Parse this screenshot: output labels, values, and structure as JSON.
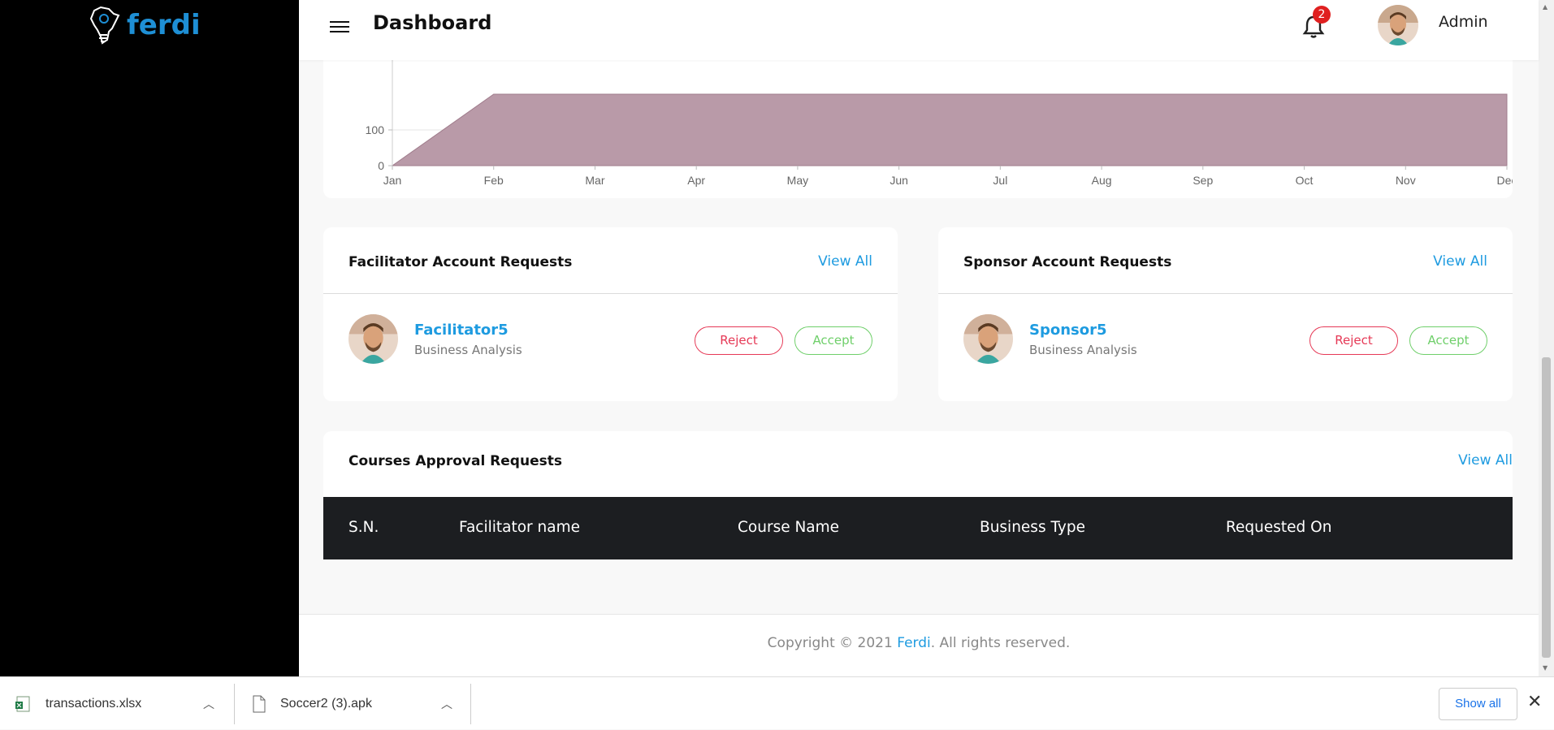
{
  "brand": {
    "name": "ferdi"
  },
  "header": {
    "title": "Dashboard",
    "notifications_count": "2",
    "user_name": "Admin"
  },
  "chart_data": {
    "type": "area",
    "x": [
      "Jan",
      "Feb",
      "Mar",
      "Apr",
      "May",
      "Jun",
      "Jul",
      "Aug",
      "Sep",
      "Oct",
      "Nov",
      "Dec"
    ],
    "series": [
      {
        "values": [
          0,
          200,
          200,
          200,
          200,
          200,
          200,
          200,
          200,
          200,
          200,
          200
        ],
        "color": "#b99aa8"
      }
    ],
    "y_ticks": [
      "0",
      "100"
    ],
    "ylim": [
      0,
      200
    ],
    "grid": true
  },
  "facilitator_requests": {
    "title": "Facilitator Account Requests",
    "view_all": "View All",
    "item": {
      "name": "Facilitator5",
      "subtitle": "Business Analysis",
      "reject": "Reject",
      "accept": "Accept"
    }
  },
  "sponsor_requests": {
    "title": "Sponsor Account Requests",
    "view_all": "View All",
    "item": {
      "name": "Sponsor5",
      "subtitle": "Business Analysis",
      "reject": "Reject",
      "accept": "Accept"
    }
  },
  "course_requests": {
    "title": "Courses Approval Requests",
    "view_all": "View All",
    "columns": [
      "S.N.",
      "Facilitator name",
      "Course Name",
      "Business Type",
      "Requested On"
    ]
  },
  "footer": {
    "prefix": "Copyright © 2021 ",
    "brand": "Ferdi",
    "suffix": ". All rights reserved."
  },
  "downloads": {
    "items": [
      {
        "name": "transactions.xlsx"
      },
      {
        "name": "Soccer2 (3).apk"
      }
    ],
    "show_all": "Show all"
  },
  "colors": {
    "accent": "#1e9be0",
    "reject": "#e63956",
    "accept": "#6fcf6a",
    "table_header": "#1c1e21"
  }
}
